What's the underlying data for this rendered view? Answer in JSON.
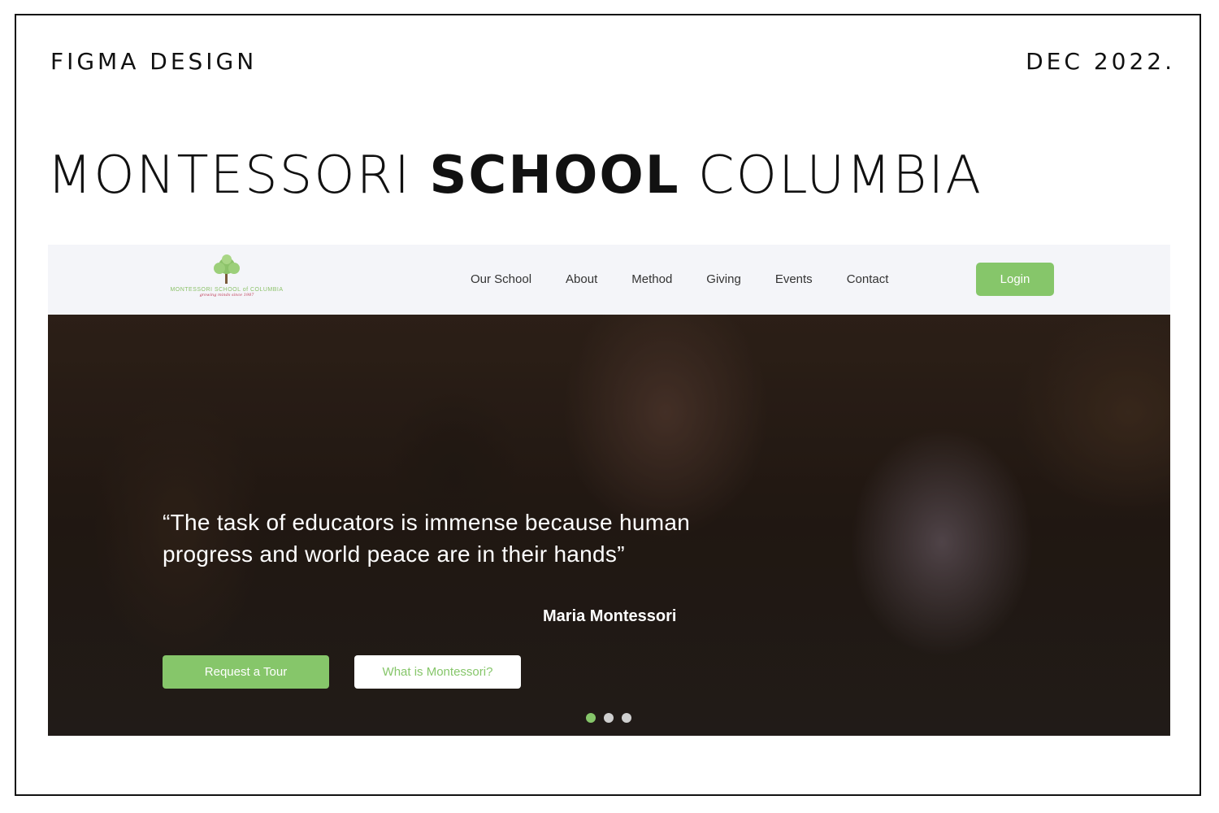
{
  "header": {
    "left_label": "FIGMA DESIGN",
    "right_label": "DEC 2022."
  },
  "title": {
    "part1": "MONTESSORI ",
    "part2": "SCHOOL",
    "part3": " COLUMBIA"
  },
  "site": {
    "logo": {
      "name": "MONTESSORI SCHOOL of COLUMBIA",
      "tagline": "growing minds since 1987",
      "icon": "tree-icon"
    },
    "nav": {
      "items": [
        {
          "label": "Our School"
        },
        {
          "label": "About"
        },
        {
          "label": "Method"
        },
        {
          "label": "Giving"
        },
        {
          "label": "Events"
        },
        {
          "label": "Contact"
        }
      ],
      "login_label": "Login"
    },
    "hero": {
      "quote": "“The task of educators is immense because human progress and world peace are in their hands”",
      "author": "Maria Montessori",
      "primary_button": "Request a Tour",
      "secondary_button": "What is Montessori?",
      "carousel": {
        "count": 3,
        "active_index": 0
      }
    }
  },
  "colors": {
    "accent_green": "#86c66a",
    "nav_background": "#f4f5f9",
    "logo_tagline": "#c0405a"
  }
}
